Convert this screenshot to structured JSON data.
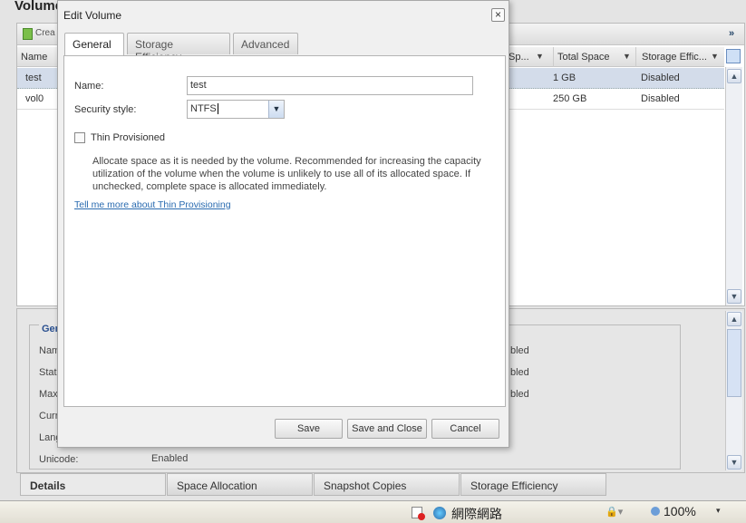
{
  "page": {
    "title": "Volume"
  },
  "toolbar": {
    "create_label": "Crea",
    "more_label": "»"
  },
  "grid": {
    "columns": [
      {
        "label": "Name"
      },
      {
        "label": "Sp..."
      },
      {
        "label": "Total Space"
      },
      {
        "label": "Storage Effic..."
      }
    ],
    "rows": [
      {
        "name": "test",
        "total": "1 GB",
        "eff": "Disabled",
        "selected": true
      },
      {
        "name": "vol0",
        "total": "250 GB",
        "eff": "Disabled",
        "selected": false
      }
    ]
  },
  "details": {
    "legend": "Gen",
    "labels": [
      "Nam",
      "Stat",
      "Max",
      "Curr",
      "Lang",
      "Unicode:"
    ],
    "unicode_value": "Enabled",
    "right_values": [
      "bled",
      "bled",
      "bled"
    ],
    "tabs": [
      "Details",
      "Space Allocation",
      "Snapshot Copies",
      "Storage Efficiency"
    ]
  },
  "dialog": {
    "title": "Edit Volume",
    "close": "×",
    "tabs": [
      "General",
      "Storage Efficiency",
      "Advanced"
    ],
    "name_label": "Name:",
    "name_value": "test",
    "security_label": "Security style:",
    "security_value": "NTFS",
    "thin_label": "Thin Provisioned",
    "thin_checked": false,
    "thin_desc": "Allocate space as it is needed by the volume. Recommended for increasing the capacity utilization of the volume when the volume is unlikely to use all of its allocated space. If unchecked, complete space is allocated immediately.",
    "link": "Tell me more about Thin Provisioning",
    "buttons": {
      "save": "Save",
      "save_close": "Save and Close",
      "cancel": "Cancel"
    }
  },
  "statusbar": {
    "zone": "網際網路",
    "zoom": "100%"
  }
}
